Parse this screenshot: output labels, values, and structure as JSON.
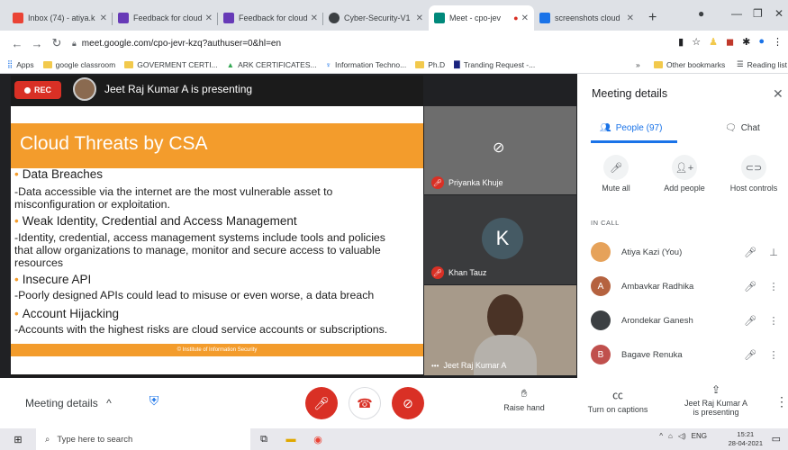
{
  "browser": {
    "tabs": [
      {
        "title": "Inbox (74) - atiya.k",
        "color": "#ea4335"
      },
      {
        "title": "Feedback for cloud",
        "color": "#673ab7"
      },
      {
        "title": "Feedback for cloud",
        "color": "#673ab7"
      },
      {
        "title": "Cyber-Security-V1",
        "color": "#5f6368"
      },
      {
        "title": "Meet - cpo-jev",
        "color": "#00897b"
      },
      {
        "title": "screenshots cloud",
        "color": "#1a73e8"
      }
    ],
    "url": "meet.google.com/cpo-jevr-kzq?authuser=0&hl=en",
    "bookmarks": [
      "Apps",
      "google classroom",
      "GOVERMENT CERTI...",
      "ARK CERTIFICATES...",
      "Information Techno...",
      "Ph.D",
      "Tranding Request -..."
    ],
    "bookmarks_right": [
      "Other bookmarks",
      "Reading list"
    ]
  },
  "meet": {
    "rec_label": "REC",
    "presenting_text": "Jeet Raj Kumar A is presenting",
    "slide": {
      "title": "Cloud Threats by CSA",
      "lines": [
        {
          "text": "Data Breaches",
          "bullet": true
        },
        {
          "text": "-Data accessible via the internet are the most vulnerable asset to",
          "bullet": false
        },
        {
          "text": "misconfiguration or exploitation.",
          "bullet": false
        },
        {
          "text": "Weak Identity, Credential and Access Management",
          "bullet": true
        },
        {
          "text": "-Identity, credential, access management systems include tools and policies",
          "bullet": false
        },
        {
          "text": "that allow organizations to manage, monitor and secure access to valuable",
          "bullet": false
        },
        {
          "text": "resources",
          "bullet": false
        },
        {
          "text": "Insecure API",
          "bullet": true
        },
        {
          "text": "-Poorly designed APIs could lead to misuse or even worse, a data breach",
          "bullet": false
        },
        {
          "text": "Account Hijacking",
          "bullet": true
        },
        {
          "text": "-Accounts with the highest risks are cloud service accounts or subscriptions.",
          "bullet": false
        }
      ],
      "footer": "© Institute of Information Security"
    },
    "tiles": [
      {
        "name": "Priyanka Khuje"
      },
      {
        "name": "Khan Tauz",
        "initial": "K"
      },
      {
        "name": "Jeet Raj Kumar A"
      }
    ],
    "panel": {
      "title": "Meeting details",
      "people_tab": "People (97)",
      "chat_tab": "Chat",
      "actions": [
        "Mute all",
        "Add people",
        "Host controls"
      ],
      "in_call_label": "IN CALL",
      "participants": [
        {
          "name": "Atiya Kazi (You)",
          "initial": "",
          "color": "#e6a25a"
        },
        {
          "name": "Ambavkar Radhika",
          "initial": "A",
          "color": "#b5623f"
        },
        {
          "name": "Arondekar Ganesh",
          "initial": "",
          "color": "#3c4043"
        },
        {
          "name": "Bagave Renuka",
          "initial": "B",
          "color": "#c0504d"
        }
      ]
    },
    "controls": {
      "meeting_details": "Meeting details",
      "raise_hand": "Raise hand",
      "captions": "Turn on captions",
      "presenting_line1": "Jeet Raj Kumar A",
      "presenting_line2": "is presenting"
    }
  },
  "taskbar": {
    "search_placeholder": "Type here to search",
    "language": "ENG",
    "time": "15:21",
    "date": "28-04-2021"
  }
}
